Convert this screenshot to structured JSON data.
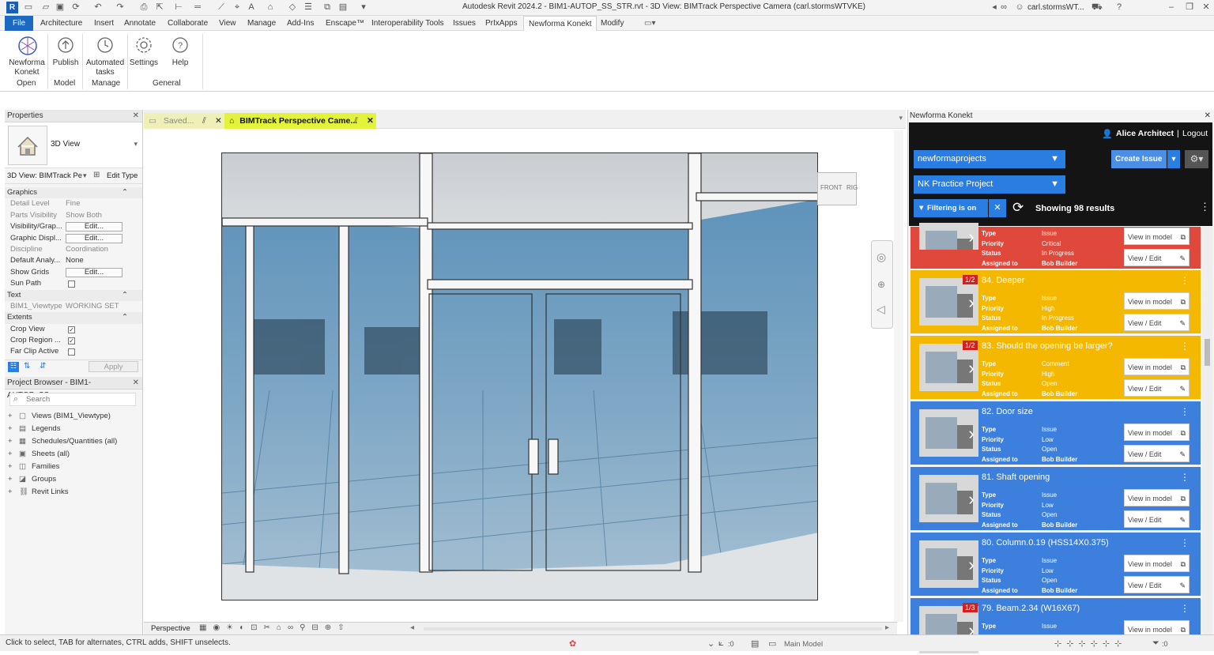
{
  "titlebar": {
    "title": "Autodesk Revit 2024.2 - BIM1-AUTOP_SS_STR.rvt - 3D View: BIMTrack Perspective Camera (carl.stormsWTVKE)",
    "user": "carl.stormsWT..."
  },
  "menubar": {
    "tabs": [
      "File",
      "Architecture",
      "Insert",
      "Annotate",
      "Collaborate",
      "View",
      "Manage",
      "Add-Ins",
      "Enscape™",
      "Interoperability Tools",
      "Issues",
      "PrIxApps",
      "Newforma Konekt",
      "Modify"
    ]
  },
  "ribbon": {
    "buttons": [
      {
        "label": "Newforma\nKonekt",
        "icon": "konekt-logo-icon"
      },
      {
        "label": "Publish",
        "icon": "publish-icon"
      },
      {
        "label": "Automated\ntasks",
        "icon": "clock-icon"
      },
      {
        "label": "Settings",
        "icon": "gear-icon"
      },
      {
        "label": "Help",
        "icon": "help-icon"
      }
    ],
    "groups": [
      "Open",
      "Model",
      "Manage",
      "General"
    ]
  },
  "properties": {
    "header": "Properties",
    "type_name": "3D View",
    "instance_selector": "3D View: BIMTrack Pe",
    "edit_type": "Edit Type",
    "sections": {
      "graphics": "Graphics",
      "text": "Text",
      "extents": "Extents"
    },
    "rows": [
      {
        "k": "Detail Level",
        "v": "Fine",
        "dim": true
      },
      {
        "k": "Parts Visibility",
        "v": "Show Both",
        "dim": true
      },
      {
        "k": "Visibility/Grap...",
        "v": "Edit...",
        "btn": true
      },
      {
        "k": "Graphic Displ...",
        "v": "Edit...",
        "btn": true
      },
      {
        "k": "Discipline",
        "v": "Coordination",
        "dim": true
      },
      {
        "k": "Default Analy...",
        "v": "None"
      },
      {
        "k": "Show Grids",
        "v": "Edit...",
        "btn": true
      },
      {
        "k": "Sun Path",
        "v": ""
      }
    ],
    "text_rows": [
      {
        "k": "BIM1_Viewtype",
        "v": "WORKING SET"
      }
    ],
    "extent_rows": [
      {
        "k": "Crop View",
        "checked": true
      },
      {
        "k": "Crop Region ...",
        "checked": true
      },
      {
        "k": "Far Clip Active",
        "checked": false
      }
    ],
    "apply": "Apply"
  },
  "browser": {
    "header": "Project Browser - BIM1-AUTOP_SS_...",
    "search_placeholder": "Search",
    "items": [
      "Views (BIM1_Viewtype)",
      "Legends",
      "Schedules/Quantities (all)",
      "Sheets (all)",
      "Families",
      "Groups",
      "Revit Links"
    ]
  },
  "viewtabs": {
    "saved": "Saved...",
    "active": "BIMTrack Perspective Came..."
  },
  "viewcube": {
    "front": "FRONT",
    "side": "RIG"
  },
  "viewbar": {
    "mode": "Perspective"
  },
  "konekt": {
    "panel_title": "Newforma Konekt",
    "user": "Alice Architect",
    "logout": "Logout",
    "project_group": "newformaprojects",
    "project": "NK Practice Project",
    "create_issue": "Create Issue",
    "filter": "Filtering is on",
    "results": "Showing 98 results",
    "field_labels": [
      "Type",
      "Priority",
      "Status",
      "Assigned to"
    ],
    "view_in_model": "View in model",
    "view_edit": "View / Edit"
  },
  "issues": [
    {
      "title": "",
      "badge": "",
      "color": "#e0483b",
      "type": "Issue",
      "priority": "Critical",
      "status": "In Progress",
      "assigned": "Bob Builder"
    },
    {
      "title": "84.  Deeper",
      "badge": "1/2",
      "color": "#f4b800",
      "type": "Issue",
      "priority": "High",
      "status": "In Progress",
      "assigned": "Bob Builder"
    },
    {
      "title": "83.  Should the opening be larger?",
      "badge": "1/2",
      "color": "#f4b800",
      "type": "Comment",
      "priority": "High",
      "status": "Open",
      "assigned": "Bob Builder"
    },
    {
      "title": "82.  Door size",
      "badge": "",
      "color": "#3d7fdc",
      "type": "Issue",
      "priority": "Low",
      "status": "Open",
      "assigned": "Bob Builder"
    },
    {
      "title": "81.  Shaft opening",
      "badge": "",
      "color": "#3d7fdc",
      "type": "Issue",
      "priority": "Low",
      "status": "Open",
      "assigned": "Bob Builder"
    },
    {
      "title": "80.  Column.0.19 (HSS14X0.375)",
      "badge": "",
      "color": "#3d7fdc",
      "type": "Issue",
      "priority": "Low",
      "status": "Open",
      "assigned": "Bob Builder"
    },
    {
      "title": "79.  Beam.2.34 (W16X67)",
      "badge": "1/3",
      "color": "#3d7fdc",
      "type": "Issue",
      "priority": "",
      "status": "",
      "assigned": ""
    }
  ],
  "statusbar": {
    "message": "Click to select, TAB for alternates, CTRL adds, SHIFT unselects.",
    "model": "Main Model",
    "zero1": ":0",
    "zero2": ":0"
  },
  "colors": {
    "accent": "#1d68c0",
    "konekt_blue": "#2a7de1",
    "critical": "#e0483b",
    "high": "#f4b800",
    "low": "#3d7fdc",
    "active_tab": "#e3f23a"
  }
}
